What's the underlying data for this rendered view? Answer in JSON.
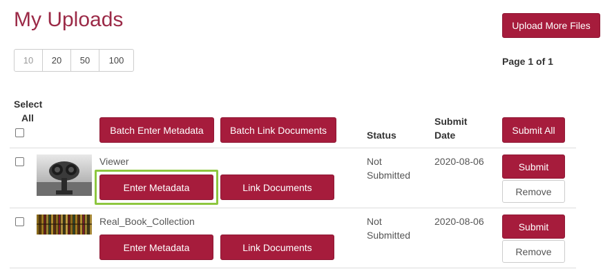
{
  "page": {
    "title": "My Uploads",
    "upload_more_label": "Upload More Files",
    "page_indicator": "Page 1 of 1"
  },
  "pager": {
    "options": [
      "10",
      "20",
      "50",
      "100"
    ]
  },
  "table_header": {
    "select_all_line1": "Select",
    "select_all_line2": "All",
    "batch_metadata_label": "Batch Enter Metadata",
    "batch_link_label": "Batch Link Documents",
    "status_label": "Status",
    "submit_date_line1": "Submit",
    "submit_date_line2": "Date",
    "submit_all_label": "Submit All"
  },
  "rows": [
    {
      "name": "Viewer",
      "enter_metadata_label": "Enter Metadata",
      "link_documents_label": "Link Documents",
      "status_line1": "Not",
      "status_line2": "Submitted",
      "date": "2020-08-06",
      "submit_label": "Submit",
      "remove_label": "Remove"
    },
    {
      "name": "Real_Book_Collection",
      "enter_metadata_label": "Enter Metadata",
      "link_documents_label": "Link Documents",
      "status_line1": "Not",
      "status_line2": "Submitted",
      "date": "2020-08-06",
      "submit_label": "Submit",
      "remove_label": "Remove"
    }
  ],
  "colors": {
    "brand": "#a61c3c",
    "title": "#9b2a47",
    "highlight": "#8dc63f"
  }
}
